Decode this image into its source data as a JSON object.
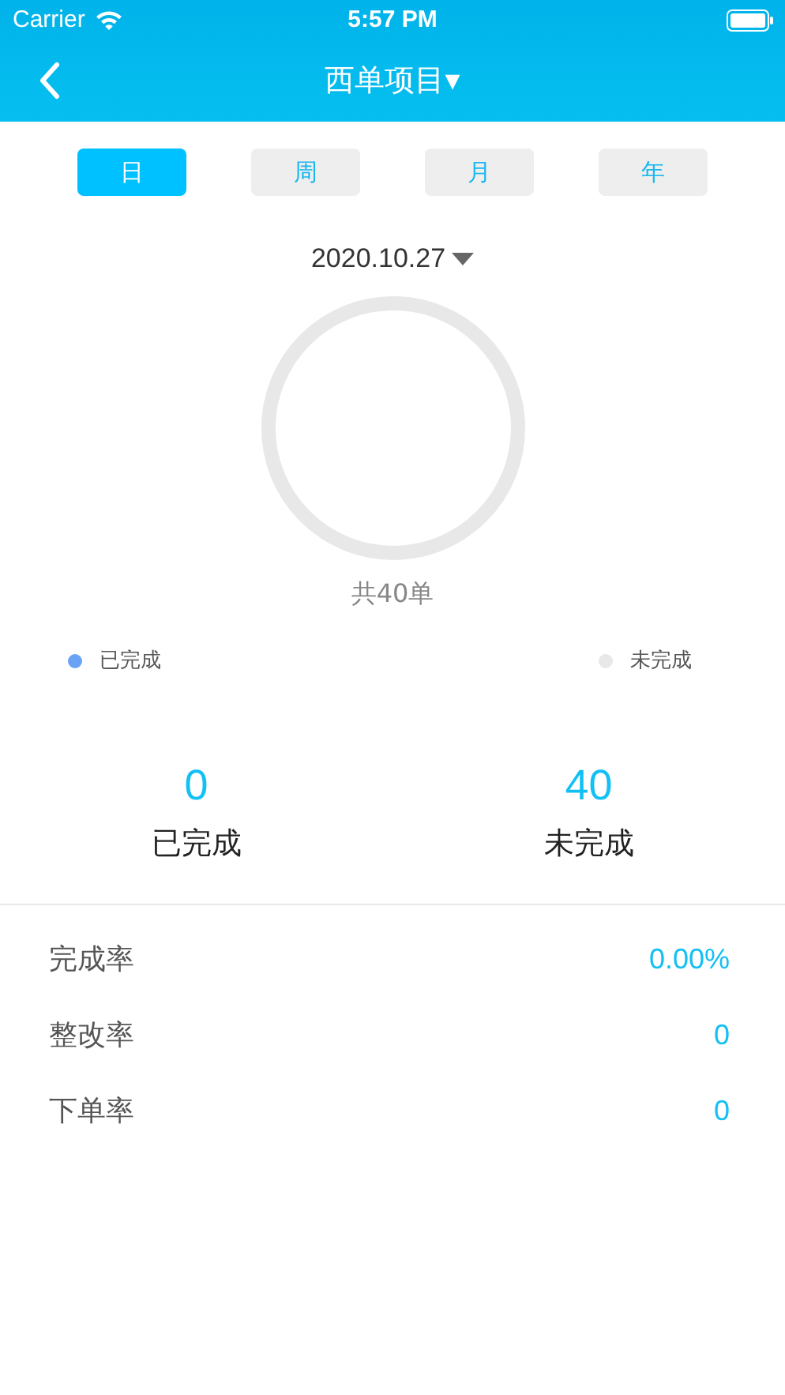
{
  "status_bar": {
    "carrier": "Carrier",
    "time": "5:57 PM"
  },
  "nav": {
    "title": "西单项目▾"
  },
  "tabs": [
    {
      "label": "日",
      "selected": true
    },
    {
      "label": "周",
      "selected": false
    },
    {
      "label": "月",
      "selected": false
    },
    {
      "label": "年",
      "selected": false
    }
  ],
  "date": "2020.10.27",
  "total": "共40单",
  "legend": [
    {
      "label": "已完成",
      "color": "#6aa3f5"
    },
    {
      "label": "未完成",
      "color": "#e8e8e8"
    }
  ],
  "stats": [
    {
      "value": "0",
      "label": "已完成"
    },
    {
      "value": "40",
      "label": "未完成"
    }
  ],
  "rates": [
    {
      "label": "完成率",
      "value": "0.00%"
    },
    {
      "label": "整改率",
      "value": "0"
    },
    {
      "label": "下单率",
      "value": "0"
    }
  ]
}
